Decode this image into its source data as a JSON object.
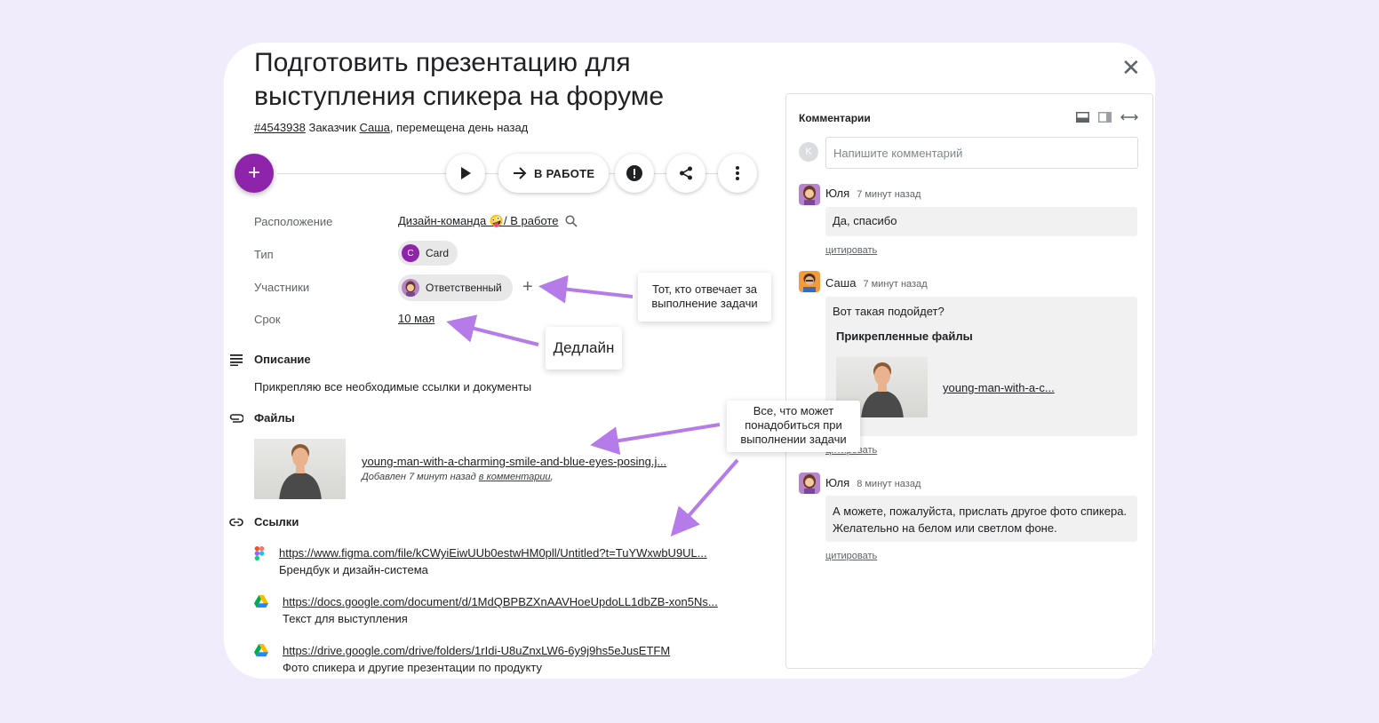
{
  "task": {
    "title": "Подготовить презентацию для выступления спикера на форуме",
    "id_link": "#4543938",
    "customer_label": "Заказчик",
    "customer_name": "Саша",
    "moved_text": ", перемещена день назад"
  },
  "toolbar": {
    "add_label": "+",
    "status_label": "В РАБОТЕ"
  },
  "fields": {
    "location_label": "Расположение",
    "location_value": "Дизайн-команда 🤪/ В работе",
    "type_label": "Тип",
    "type_chip_letter": "C",
    "type_value": "Card",
    "members_label": "Участники",
    "member_value": "Ответственный",
    "deadline_label": "Срок",
    "deadline_value": "10 мая"
  },
  "description": {
    "heading": "Описание",
    "text": "Прикрепляю все необходимые ссылки и документы"
  },
  "files": {
    "heading": "Файлы",
    "items": [
      {
        "name": "young-man-with-a-charming-smile-and-blue-eyes-posing.j...",
        "added": "Добавлен 7 минут назад",
        "in_comment": "в комментарии",
        "trailing": ","
      }
    ]
  },
  "links": {
    "heading": "Ссылки",
    "items": [
      {
        "icon": "figma-icon",
        "url": "https://www.figma.com/file/kCWyiEiwUUb0estwHM0pll/Untitled?t=TuYWxwbU9UL...",
        "desc": "Брендбук и дизайн-система"
      },
      {
        "icon": "google-drive-icon",
        "url": "https://docs.google.com/document/d/1MdQBPBZXnAAVHoeUpdoLL1dbZB-xon5Ns...",
        "desc": "Текст для выступления"
      },
      {
        "icon": "google-drive-icon",
        "url": "https://drive.google.com/drive/folders/1rIdi-U8uZnxLW6-6y9j9hs5eJusETFM",
        "desc": "Фото спикера и другие презентации по продукту"
      }
    ]
  },
  "comments": {
    "title": "Комментарии",
    "input_placeholder": "Напишите комментарий",
    "user_initial": "K",
    "quote_label": "цитировать",
    "items": [
      {
        "author": "Юля",
        "time": "7 минут назад",
        "text": "Да, спасибо"
      },
      {
        "author": "Саша",
        "time": "7 минут назад",
        "text": "Вот такая подойдет?",
        "attachments_title": "Прикрепленные файлы",
        "attachment_name": "young-man-with-a-c..."
      },
      {
        "author": "Юля",
        "time": "8 минут назад",
        "text": "А можете, пожалуйста, прислать другое фото спикера. Желательно на белом или светлом фоне."
      }
    ]
  },
  "annotations": {
    "responsible": "Тот, кто отвечает за выполнение задачи",
    "deadline": "Дедлайн",
    "files": "Все, что может понадобиться при выполнении задачи"
  },
  "colors": {
    "page_bg": "#f1ecfb",
    "accent": "#8e24aa",
    "annotation_arrow": "#b57be8"
  }
}
